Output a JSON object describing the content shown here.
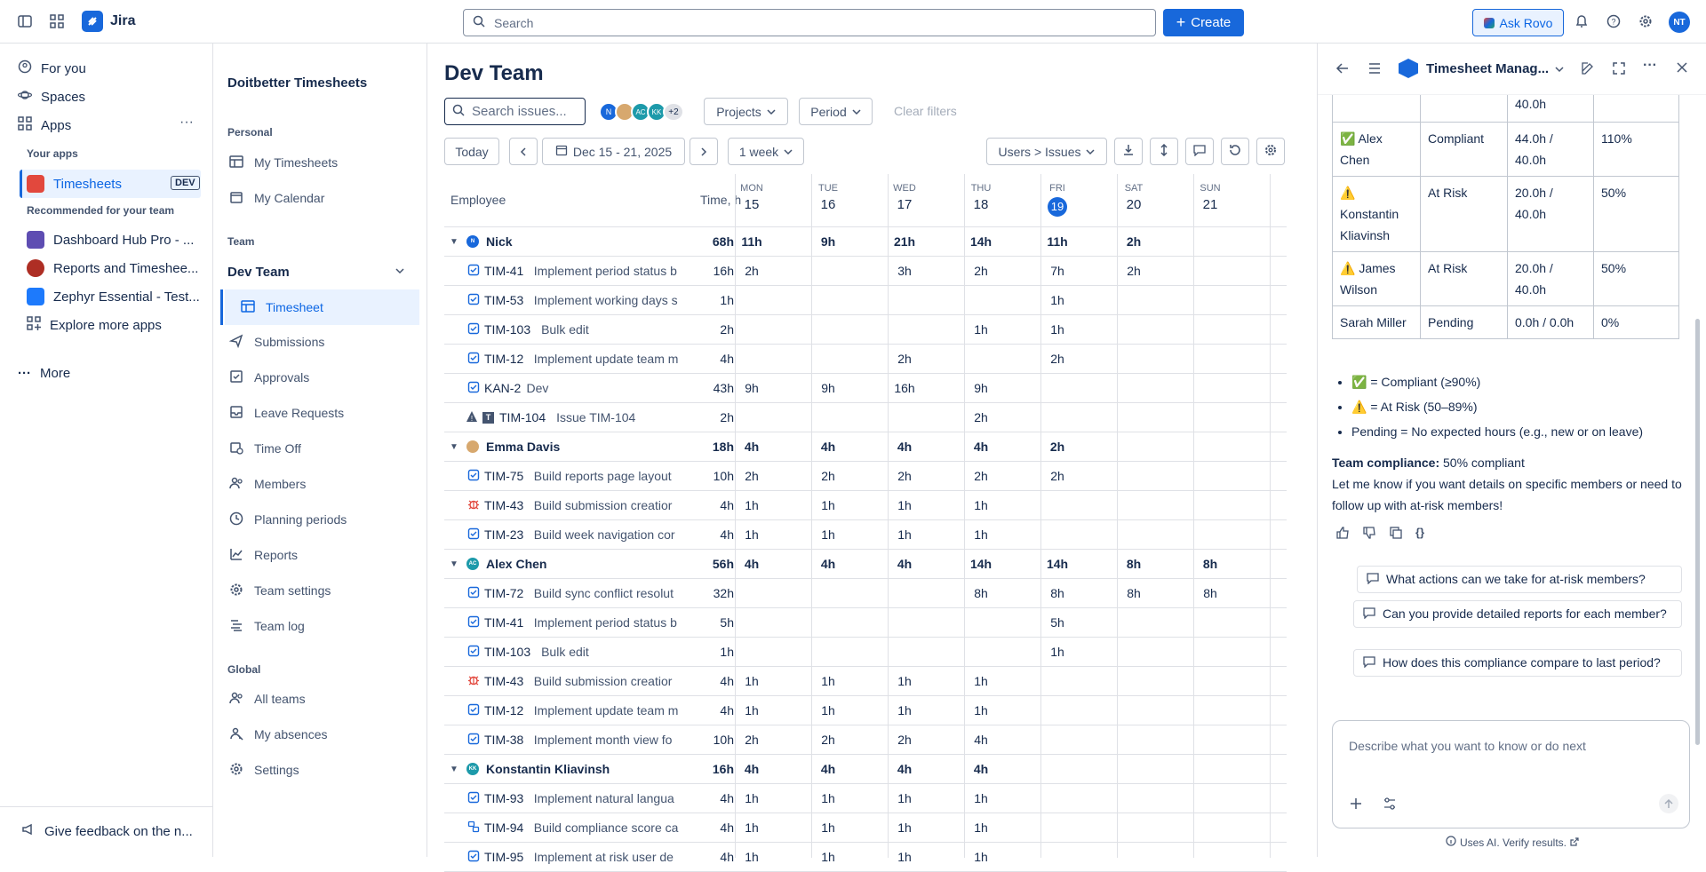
{
  "topbar": {
    "app": "Jira",
    "search_placeholder": "Search",
    "create": "Create",
    "ask_rovo": "Ask Rovo",
    "avatar": "NT"
  },
  "leftnav": {
    "for_you": "For you",
    "spaces": "Spaces",
    "apps": "Apps",
    "your_apps": "Your apps",
    "timesheets": "Timesheets",
    "dev_badge": "DEV",
    "recommended": "Recommended for your team",
    "rec": [
      "Dashboard Hub Pro - ...",
      "Reports and Timeshee...",
      "Zephyr Essential - Test..."
    ],
    "explore": "Explore more apps",
    "more": "More",
    "feedback": "Give feedback on the n..."
  },
  "sidebar": {
    "title": "Doitbetter Timesheets",
    "personal": "Personal",
    "my_timesheets": "My Timesheets",
    "my_calendar": "My Calendar",
    "team": "Team",
    "dev_team": "Dev Team",
    "items": [
      "Timesheet",
      "Submissions",
      "Approvals",
      "Leave Requests",
      "Time Off",
      "Members",
      "Planning periods",
      "Reports",
      "Team settings",
      "Team log"
    ],
    "global": "Global",
    "global_items": [
      "All teams",
      "My absences",
      "Settings"
    ]
  },
  "main": {
    "title": "Dev Team",
    "search_placeholder": "Search issues...",
    "avatars": [
      "N",
      "AC",
      "KK"
    ],
    "more_avatars": "+2",
    "projects": "Projects",
    "period": "Period",
    "clear": "Clear filters",
    "today": "Today",
    "range": "Dec 15 - 21, 2025",
    "week": "1 week",
    "view": "Users > Issues",
    "col_employee": "Employee",
    "col_time": "Time, h",
    "days": [
      {
        "d": "MON",
        "n": "15"
      },
      {
        "d": "TUE",
        "n": "16"
      },
      {
        "d": "WED",
        "n": "17"
      },
      {
        "d": "THU",
        "n": "18"
      },
      {
        "d": "FRI",
        "n": "19"
      },
      {
        "d": "SAT",
        "n": "20"
      },
      {
        "d": "SUN",
        "n": "21"
      }
    ],
    "rows": [
      {
        "type": "group",
        "name": "Nick",
        "av": "N",
        "total": "68h",
        "v": [
          "11h",
          "9h",
          "21h",
          "14h",
          "11h",
          "2h",
          ""
        ]
      },
      {
        "type": "issue",
        "key": "TIM-41",
        "title": "Implement period status b",
        "total": "16h",
        "v": [
          "2h",
          "",
          "3h",
          "2h",
          "7h",
          "2h",
          ""
        ]
      },
      {
        "type": "issue",
        "key": "TIM-53",
        "title": "Implement working days s",
        "total": "1h",
        "v": [
          "",
          "",
          "",
          "",
          "1h",
          "",
          ""
        ]
      },
      {
        "type": "issue",
        "key": "TIM-103",
        "title": "Bulk edit",
        "total": "2h",
        "v": [
          "",
          "",
          "",
          "1h",
          "1h",
          "",
          ""
        ]
      },
      {
        "type": "issue",
        "key": "TIM-12",
        "title": "Implement update team m",
        "total": "4h",
        "v": [
          "",
          "",
          "2h",
          "",
          "2h",
          "",
          ""
        ]
      },
      {
        "type": "issue",
        "key": "KAN-2",
        "title": "Dev",
        "total": "43h",
        "v": [
          "9h",
          "9h",
          "16h",
          "9h",
          "",
          "",
          ""
        ]
      },
      {
        "type": "warn",
        "key": "TIM-104",
        "title": "Issue TIM-104",
        "total": "2h",
        "v": [
          "",
          "",
          "",
          "2h",
          "",
          "",
          ""
        ]
      },
      {
        "type": "group",
        "name": "Emma Davis",
        "av": "E",
        "total": "18h",
        "v": [
          "4h",
          "4h",
          "4h",
          "4h",
          "2h",
          "",
          ""
        ]
      },
      {
        "type": "issue",
        "key": "TIM-75",
        "title": "Build reports page layout",
        "total": "10h",
        "v": [
          "2h",
          "2h",
          "2h",
          "2h",
          "2h",
          "",
          ""
        ]
      },
      {
        "type": "bug",
        "key": "TIM-43",
        "title": "Build submission creatior",
        "total": "4h",
        "v": [
          "1h",
          "1h",
          "1h",
          "1h",
          "",
          "",
          ""
        ]
      },
      {
        "type": "issue",
        "key": "TIM-23",
        "title": "Build week navigation cor",
        "total": "4h",
        "v": [
          "1h",
          "1h",
          "1h",
          "1h",
          "",
          "",
          ""
        ]
      },
      {
        "type": "group",
        "name": "Alex Chen",
        "av": "AC",
        "total": "56h",
        "v": [
          "4h",
          "4h",
          "4h",
          "14h",
          "14h",
          "8h",
          "8h"
        ]
      },
      {
        "type": "issue",
        "key": "TIM-72",
        "title": "Build sync conflict resolut",
        "total": "32h",
        "v": [
          "",
          "",
          "",
          "8h",
          "8h",
          "8h",
          "8h"
        ]
      },
      {
        "type": "issue",
        "key": "TIM-41",
        "title": "Implement period status b",
        "total": "5h",
        "v": [
          "",
          "",
          "",
          "",
          "5h",
          "",
          ""
        ]
      },
      {
        "type": "issue",
        "key": "TIM-103",
        "title": "Bulk edit",
        "total": "1h",
        "v": [
          "",
          "",
          "",
          "",
          "1h",
          "",
          ""
        ]
      },
      {
        "type": "bug",
        "key": "TIM-43",
        "title": "Build submission creatior",
        "total": "4h",
        "v": [
          "1h",
          "1h",
          "1h",
          "1h",
          "",
          "",
          ""
        ]
      },
      {
        "type": "issue",
        "key": "TIM-12",
        "title": "Implement update team m",
        "total": "4h",
        "v": [
          "1h",
          "1h",
          "1h",
          "1h",
          "",
          "",
          ""
        ]
      },
      {
        "type": "issue",
        "key": "TIM-38",
        "title": "Implement month view fo",
        "total": "10h",
        "v": [
          "2h",
          "2h",
          "2h",
          "4h",
          "",
          "",
          ""
        ]
      },
      {
        "type": "group",
        "name": "Konstantin Kliavinsh",
        "av": "KK",
        "total": "16h",
        "v": [
          "4h",
          "4h",
          "4h",
          "4h",
          "",
          "",
          ""
        ]
      },
      {
        "type": "issue",
        "key": "TIM-93",
        "title": "Implement natural langua",
        "total": "4h",
        "v": [
          "1h",
          "1h",
          "1h",
          "1h",
          "",
          "",
          ""
        ]
      },
      {
        "type": "sub",
        "key": "TIM-94",
        "title": "Build compliance score ca",
        "total": "4h",
        "v": [
          "1h",
          "1h",
          "1h",
          "1h",
          "",
          "",
          ""
        ]
      },
      {
        "type": "issue",
        "key": "TIM-95",
        "title": "Implement at risk user de",
        "total": "4h",
        "v": [
          "1h",
          "1h",
          "1h",
          "1h",
          "",
          "",
          ""
        ]
      }
    ]
  },
  "rovo": {
    "title": "Timesheet Manag...",
    "table": [
      {
        "n": "",
        "s": "",
        "h": "40.0h",
        "p": ""
      },
      {
        "n": "✅ Alex Chen",
        "s": "Compliant",
        "h": "44.0h / 40.0h",
        "p": "110%"
      },
      {
        "n": "⚠️ Konstantin Kliavinsh",
        "s": "At Risk",
        "h": "20.0h / 40.0h",
        "p": "50%"
      },
      {
        "n": "⚠️ James Wilson",
        "s": "At Risk",
        "h": "20.0h / 40.0h",
        "p": "50%"
      },
      {
        "n": "Sarah Miller",
        "s": "Pending",
        "h": "0.0h / 0.0h",
        "p": "0%"
      }
    ],
    "legend": [
      "✅ = Compliant (≥90%)",
      "⚠️ = At Risk (50–89%)",
      "Pending = No expected hours (e.g., new or on leave)"
    ],
    "compliance_label": "Team compliance:",
    "compliance_value": " 50% compliant",
    "followup": "Let me know if you want details on specific members or need to follow up with at-risk members!",
    "suggestions": [
      "What actions can we take for at-risk members?",
      "Can you provide detailed reports for each member?",
      "How does this compliance compare to last period?"
    ],
    "input_placeholder": "Describe what you want to know or do next",
    "disclaimer": "Uses AI. Verify results."
  },
  "colors": {
    "brand": "#1868db",
    "border": "#dfe1e6",
    "active_bg": "#e9f2ff"
  }
}
